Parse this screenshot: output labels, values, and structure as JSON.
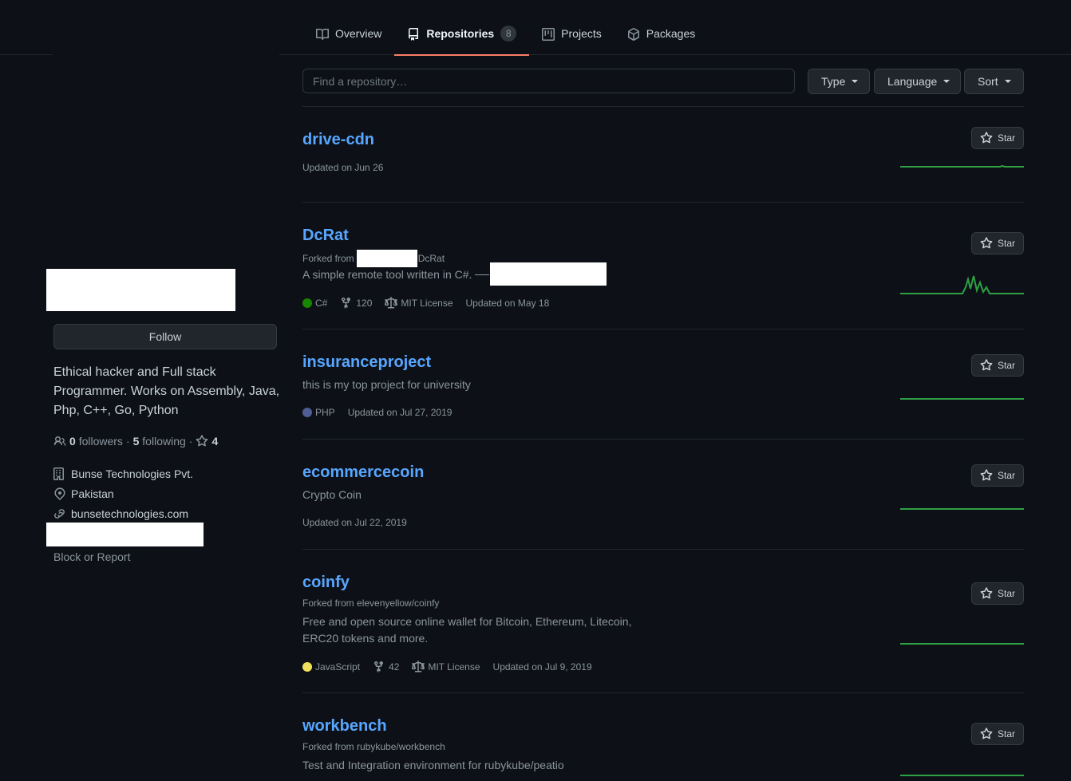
{
  "nav": {
    "tabs": [
      {
        "label": "Overview",
        "icon": "book-icon"
      },
      {
        "label": "Repositories",
        "icon": "repo-icon",
        "count": "8"
      },
      {
        "label": "Projects",
        "icon": "project-icon"
      },
      {
        "label": "Packages",
        "icon": "package-icon"
      }
    ],
    "selected": "Repositories"
  },
  "profile": {
    "follow_label": "Follow",
    "bio": "Ethical hacker and Full stack Programmer. Works on Assembly, Java, Php, C++, Go, Python",
    "followers_count": "0",
    "followers_label": "followers",
    "following_count": "5",
    "following_label": "following",
    "stars_count": "4",
    "separator": "·",
    "company": "Bunse Technologies Pvt.",
    "location": "Pakistan",
    "website": "bunsetechnologies.com",
    "block_report": "Block or Report"
  },
  "filters": {
    "search_placeholder": "Find a repository…",
    "type_label": "Type",
    "language_label": "Language",
    "sort_label": "Sort"
  },
  "star_label": "Star",
  "repos": [
    {
      "name": "drive-cdn",
      "updated": "Updated on Jun 26"
    },
    {
      "name": "DcRat",
      "forked_prefix": "Forked from",
      "forked_suffix": "DcRat",
      "description": "A simple remote tool written in C#.",
      "language": "C#",
      "language_color": "#178600",
      "forks": "120",
      "license": "MIT License",
      "updated": "Updated on May 18"
    },
    {
      "name": "insuranceproject",
      "description": "this is my top project for university",
      "language": "PHP",
      "language_color": "#4F5D95",
      "updated": "Updated on Jul 27, 2019"
    },
    {
      "name": "ecommercecoin",
      "description": "Crypto Coin",
      "updated": "Updated on Jul 22, 2019"
    },
    {
      "name": "coinfy",
      "forked_from": "Forked from elevenyellow/coinfy",
      "description": "Free and open source online wallet for Bitcoin, Ethereum, Litecoin, ERC20 tokens and more.",
      "language": "JavaScript",
      "language_color": "#f1e05a",
      "forks": "42",
      "license": "MIT License",
      "updated": "Updated on Jul 9, 2019"
    },
    {
      "name": "workbench",
      "forked_from": "Forked from rubykube/workbench",
      "description": "Test and Integration environment for rubykube/peatio"
    }
  ],
  "colors": {
    "accent": "#f78166",
    "link": "#58a6ff",
    "spark": "#2ea043"
  }
}
